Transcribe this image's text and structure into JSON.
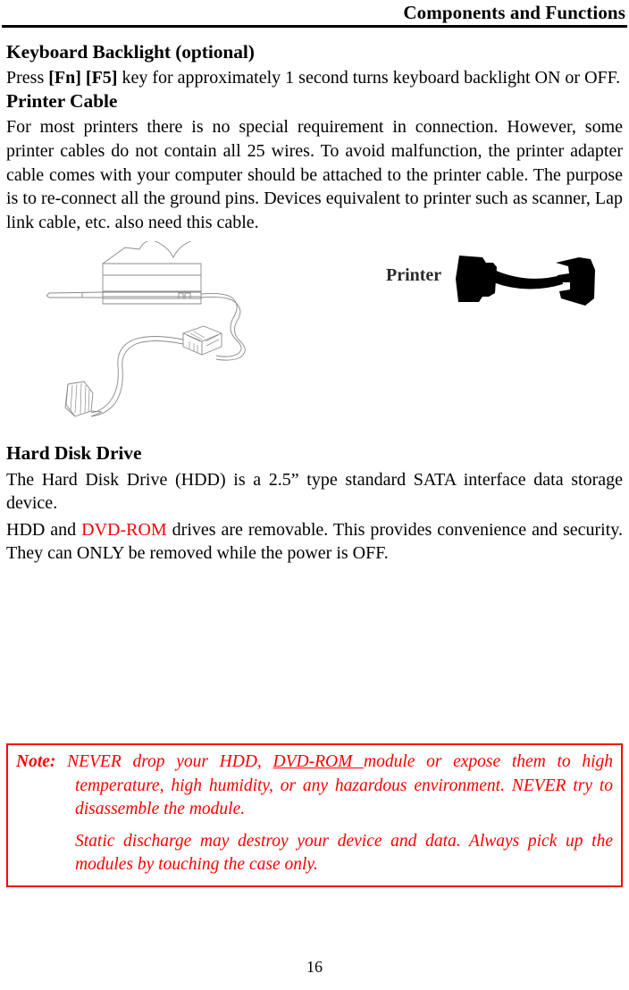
{
  "header": {
    "title": "Components and Functions"
  },
  "sections": {
    "keyboard_backlight": {
      "heading": "Keyboard Backlight (optional)",
      "paragraph": {
        "lead": "Press ",
        "key1": "[Fn]",
        "spacer": " ",
        "key2": "[F5]",
        "rest": " key for approximately 1 second turns keyboard backlight ON or OFF."
      }
    },
    "printer_cable": {
      "heading": "Printer Cable",
      "paragraph": "For most printers there is no special requirement in connection. However, some printer cables do not contain all 25 wires. To avoid malfunction, the printer adapter cable comes with your computer should be attached to the printer cable. The purpose is to re-connect all the ground pins. Devices equivalent to printer such as scanner, Lap link cable, etc. also need this cable.",
      "figure": {
        "line_drawing_name": "printer-cable-line-drawing",
        "adapter_name": "printer-adapter-cable-silhouette",
        "adapter_label": "Printer"
      }
    },
    "hard_disk_drive": {
      "heading": "Hard Disk Drive",
      "paragraph1": "The Hard Disk Drive (HDD) is a 2.5” type standard SATA interface data storage device.",
      "paragraph2": {
        "part1": "HDD and ",
        "highlight": "DVD-ROM",
        "part2": " drives are removable. This provides convenience and security. They can ONLY be removed while the power is OFF."
      }
    }
  },
  "note": {
    "label": "Note:",
    "line1_part1": " NEVER drop your HDD, ",
    "line1_underlined": "DVD-ROM ",
    "line1_part2": "module or expose them to high temperature, high humidity, or any hazardous environment. NEVER try to disassemble the module.",
    "paragraph2": "Static discharge may destroy your device and data. Always pick up the modules by touching the case only."
  },
  "footer": {
    "page_number": "16"
  },
  "colors": {
    "text": "#000000",
    "accent_red": "#ff0000",
    "page_background": "#ffffff"
  }
}
